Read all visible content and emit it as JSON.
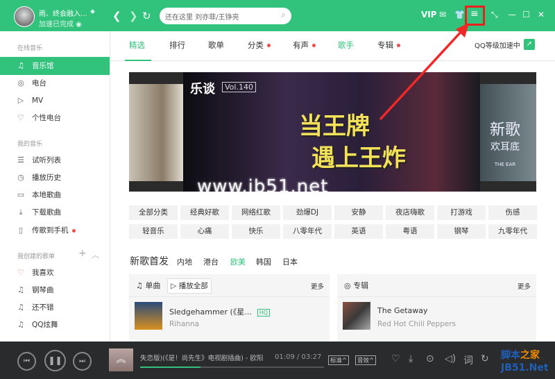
{
  "header": {
    "username": "雨、终会融入...",
    "status": "加速已完成",
    "search_placeholder": "还在这里 刘亦菲/王铮亮",
    "vip": "VIP"
  },
  "sidebar": {
    "section_online": "在线音乐",
    "online": [
      {
        "label": "音乐馆",
        "icon": "music-hall-icon"
      },
      {
        "label": "电台",
        "icon": "radio-icon"
      },
      {
        "label": "MV",
        "icon": "mv-icon"
      },
      {
        "label": "个性电台",
        "icon": "personal-radio-icon"
      }
    ],
    "section_mine": "我的音乐",
    "mine": [
      {
        "label": "试听列表",
        "icon": "playlist-icon"
      },
      {
        "label": "播放历史",
        "icon": "clock-icon"
      },
      {
        "label": "本地歌曲",
        "icon": "monitor-icon"
      },
      {
        "label": "下载歌曲",
        "icon": "download-icon"
      },
      {
        "label": "传歌到手机",
        "icon": "phone-icon"
      }
    ],
    "section_created": "我创建的歌单",
    "created": [
      {
        "label": "我喜欢",
        "icon": "heart-icon"
      },
      {
        "label": "钢琴曲",
        "icon": "note-icon"
      },
      {
        "label": "还不错",
        "icon": "note-icon"
      },
      {
        "label": "QQ炫舞",
        "icon": "note-icon"
      }
    ]
  },
  "tabs": [
    "精选",
    "排行",
    "歌单",
    "分类",
    "有声",
    "歌手",
    "专辑"
  ],
  "qq_speed": "QQ等级加速中",
  "banner": {
    "brand": "乐谈",
    "vol": "Vol.140",
    "line1": "当王牌",
    "line2": "遇上王炸",
    "right_title": "新歌",
    "right_sub": "欢耳底",
    "right_en": "THE EAR",
    "watermark": "www.jb51.net"
  },
  "categories": [
    "全部分类",
    "经典好歌",
    "网络红歌",
    "劲爆DJ",
    "安静",
    "夜店嗨歌",
    "打游戏",
    "伤感",
    "轻音乐",
    "心痛",
    "快乐",
    "八零年代",
    "英语",
    "粤语",
    "钢琴",
    "九零年代"
  ],
  "new_songs": {
    "title": "新歌首发",
    "regions": [
      "内地",
      "港台",
      "欧美",
      "韩国",
      "日本"
    ],
    "active": "欧美"
  },
  "singles": {
    "title": "单曲",
    "play_all": "播放全部",
    "more": "更多",
    "song": "Sledgehammer (《星...",
    "quality": "HQ",
    "artist": "Rihanna"
  },
  "albums": {
    "title": "专辑",
    "more": "更多",
    "album": "The Getaway",
    "artist": "Red Hot Chili Peppers"
  },
  "player": {
    "song": "失恋版)(《是！尚先生》电视剧插曲) - 欧阳",
    "time": "01:09 / 03:27",
    "progress": 0.33,
    "quality": "标准",
    "effect": "音效",
    "lyrics": "词"
  },
  "logo": {
    "line1a": "脚本",
    "line1b": "之家",
    "line2": "JB51.Net"
  }
}
